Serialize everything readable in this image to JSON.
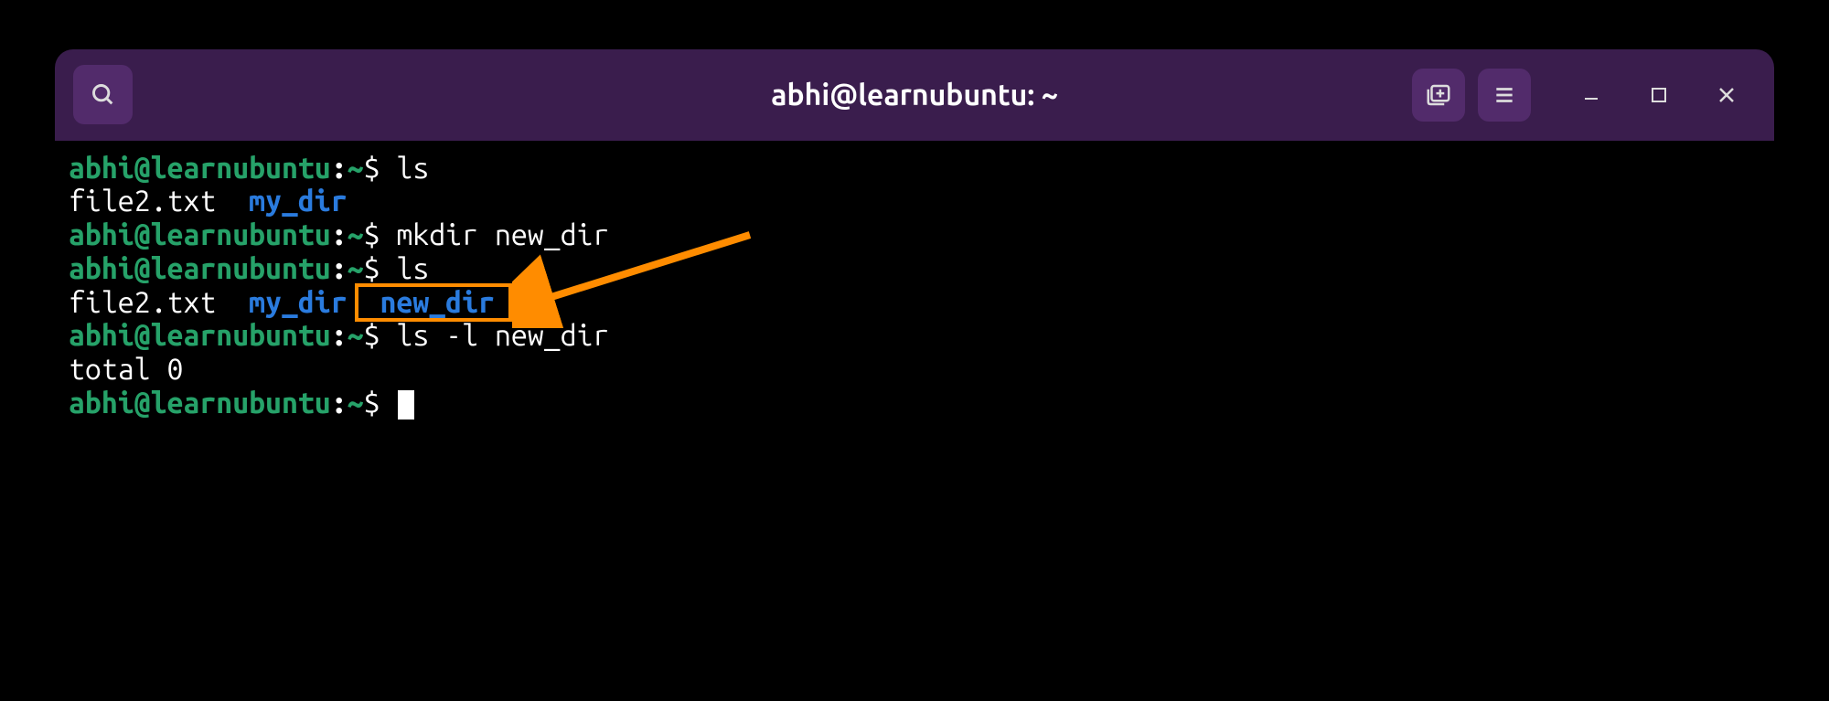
{
  "window": {
    "title": "abhi@learnubuntu: ~"
  },
  "prompt": {
    "user_host": "abhi@learnubuntu",
    "sep": ":",
    "path": "~",
    "dollar": "$"
  },
  "lines": {
    "l1_cmd": " ls",
    "l2_file": "file2.txt",
    "l2_dir": "my_dir",
    "l3_cmd": " mkdir new_dir",
    "l4_cmd": " ls",
    "l5_file": "file2.txt",
    "l5_dir1": "my_dir",
    "l5_dir2": "new_dir",
    "l6_cmd": " ls -l new_dir",
    "l7": "total 0",
    "l8_cmd": " "
  },
  "colors": {
    "titlebar": "#3a1d4d",
    "titlebar_btn": "#522b6b",
    "prompt_green": "#26a269",
    "dir_blue": "#2a7bde",
    "highlight": "#ff8c00"
  }
}
